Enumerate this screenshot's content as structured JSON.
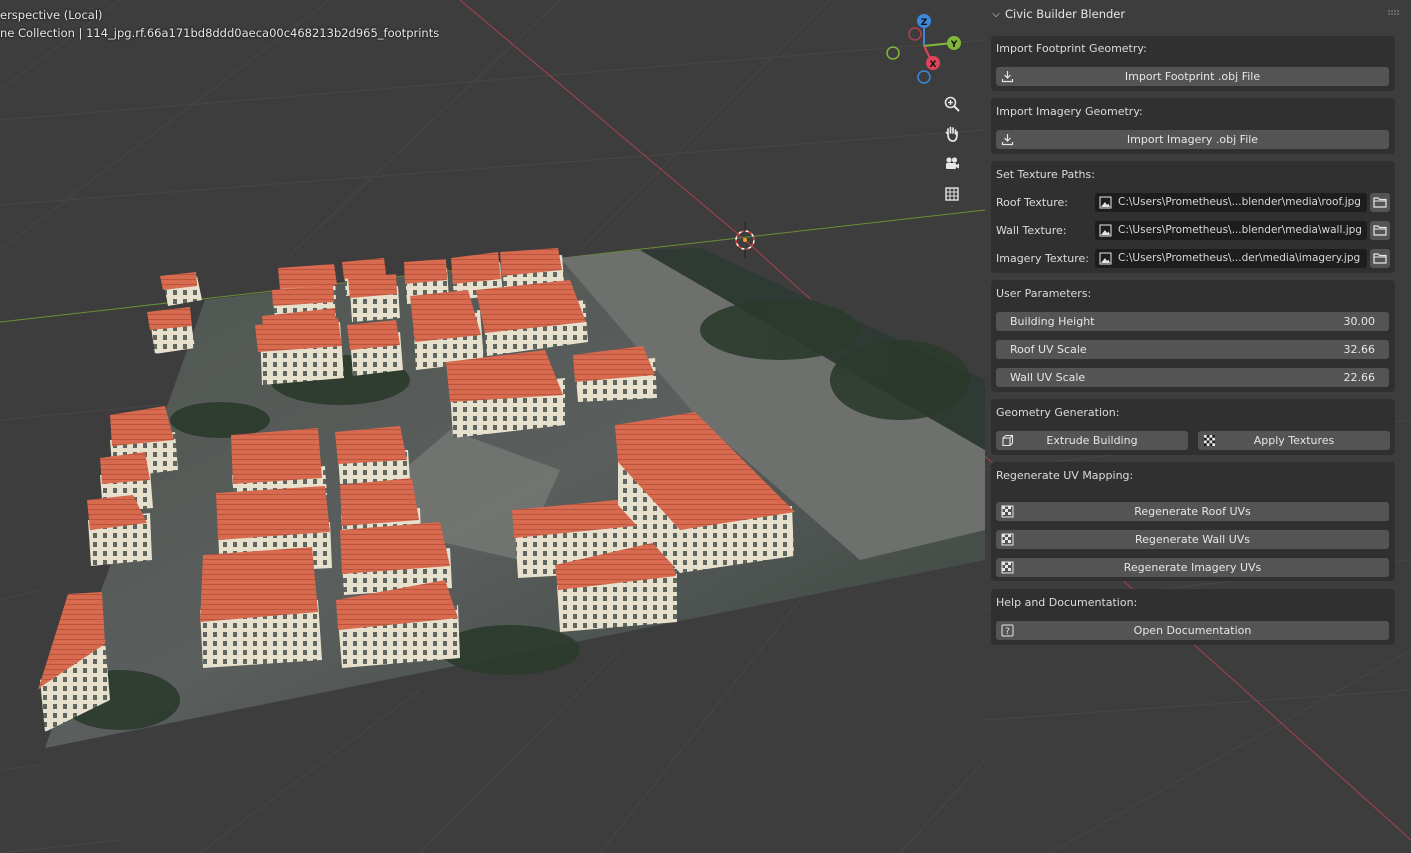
{
  "viewport": {
    "view_label": "erspective (Local)",
    "collection_label": "ne Collection | 114_jpg.rf.66a171bd8ddd0aeca00c468213b2d965_footprints",
    "gizmo": {
      "z": "Z",
      "y": "Y",
      "x": "X"
    },
    "nav_icons": [
      "zoom-icon",
      "hand-icon",
      "camera-icon",
      "grid-icon"
    ]
  },
  "panel": {
    "title": "Civic Builder Blender",
    "import_footprint": {
      "heading": "Import Footprint Geometry:",
      "button": "Import Footprint .obj File"
    },
    "import_imagery": {
      "heading": "Import Imagery Geometry:",
      "button": "Import Imagery .obj File"
    },
    "texture_paths": {
      "heading": "Set Texture Paths:",
      "roof_label": "Roof Texture:",
      "roof_value": "C:\\Users\\Prometheus\\...blender\\media\\roof.jpg",
      "wall_label": "Wall Texture:",
      "wall_value": "C:\\Users\\Prometheus\\...blender\\media\\wall.jpg",
      "imagery_label": "Imagery Texture:",
      "imagery_value": "C:\\Users\\Prometheus\\...der\\media\\imagery.jpg"
    },
    "user_params": {
      "heading": "User Parameters:",
      "building_height_label": "Building Height",
      "building_height_value": "30.00",
      "roof_uv_label": "Roof UV Scale",
      "roof_uv_value": "32.66",
      "wall_uv_label": "Wall UV Scale",
      "wall_uv_value": "22.66"
    },
    "geometry_gen": {
      "heading": "Geometry Generation:",
      "extrude": "Extrude Building",
      "apply": "Apply Textures"
    },
    "regen_uv": {
      "heading": "Regenerate UV Mapping:",
      "roof": "Regenerate Roof UVs",
      "wall": "Regenerate Wall UVs",
      "imagery": "Regenerate Imagery UVs"
    },
    "help": {
      "heading": "Help and Documentation:",
      "button": "Open Documentation"
    }
  },
  "colors": {
    "background": "#3d3d3d",
    "x_axis": "#e0435a",
    "y_axis": "#82b83a",
    "z_axis": "#3c87d8",
    "roof": "#d96a4e",
    "wall": "#e8e2cf"
  }
}
